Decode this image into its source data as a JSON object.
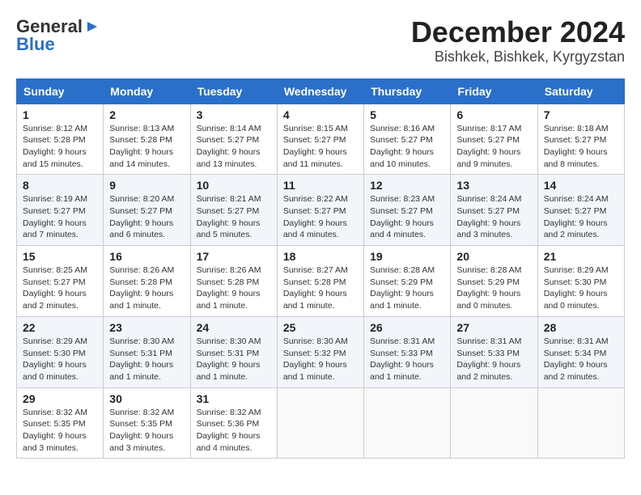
{
  "header": {
    "logo_general": "General",
    "logo_blue": "Blue",
    "month": "December 2024",
    "location": "Bishkek, Bishkek, Kyrgyzstan"
  },
  "weekdays": [
    "Sunday",
    "Monday",
    "Tuesday",
    "Wednesday",
    "Thursday",
    "Friday",
    "Saturday"
  ],
  "weeks": [
    [
      {
        "day": "1",
        "sunrise": "Sunrise: 8:12 AM",
        "sunset": "Sunset: 5:28 PM",
        "daylight": "Daylight: 9 hours and 15 minutes."
      },
      {
        "day": "2",
        "sunrise": "Sunrise: 8:13 AM",
        "sunset": "Sunset: 5:28 PM",
        "daylight": "Daylight: 9 hours and 14 minutes."
      },
      {
        "day": "3",
        "sunrise": "Sunrise: 8:14 AM",
        "sunset": "Sunset: 5:27 PM",
        "daylight": "Daylight: 9 hours and 13 minutes."
      },
      {
        "day": "4",
        "sunrise": "Sunrise: 8:15 AM",
        "sunset": "Sunset: 5:27 PM",
        "daylight": "Daylight: 9 hours and 11 minutes."
      },
      {
        "day": "5",
        "sunrise": "Sunrise: 8:16 AM",
        "sunset": "Sunset: 5:27 PM",
        "daylight": "Daylight: 9 hours and 10 minutes."
      },
      {
        "day": "6",
        "sunrise": "Sunrise: 8:17 AM",
        "sunset": "Sunset: 5:27 PM",
        "daylight": "Daylight: 9 hours and 9 minutes."
      },
      {
        "day": "7",
        "sunrise": "Sunrise: 8:18 AM",
        "sunset": "Sunset: 5:27 PM",
        "daylight": "Daylight: 9 hours and 8 minutes."
      }
    ],
    [
      {
        "day": "8",
        "sunrise": "Sunrise: 8:19 AM",
        "sunset": "Sunset: 5:27 PM",
        "daylight": "Daylight: 9 hours and 7 minutes."
      },
      {
        "day": "9",
        "sunrise": "Sunrise: 8:20 AM",
        "sunset": "Sunset: 5:27 PM",
        "daylight": "Daylight: 9 hours and 6 minutes."
      },
      {
        "day": "10",
        "sunrise": "Sunrise: 8:21 AM",
        "sunset": "Sunset: 5:27 PM",
        "daylight": "Daylight: 9 hours and 5 minutes."
      },
      {
        "day": "11",
        "sunrise": "Sunrise: 8:22 AM",
        "sunset": "Sunset: 5:27 PM",
        "daylight": "Daylight: 9 hours and 4 minutes."
      },
      {
        "day": "12",
        "sunrise": "Sunrise: 8:23 AM",
        "sunset": "Sunset: 5:27 PM",
        "daylight": "Daylight: 9 hours and 4 minutes."
      },
      {
        "day": "13",
        "sunrise": "Sunrise: 8:24 AM",
        "sunset": "Sunset: 5:27 PM",
        "daylight": "Daylight: 9 hours and 3 minutes."
      },
      {
        "day": "14",
        "sunrise": "Sunrise: 8:24 AM",
        "sunset": "Sunset: 5:27 PM",
        "daylight": "Daylight: 9 hours and 2 minutes."
      }
    ],
    [
      {
        "day": "15",
        "sunrise": "Sunrise: 8:25 AM",
        "sunset": "Sunset: 5:27 PM",
        "daylight": "Daylight: 9 hours and 2 minutes."
      },
      {
        "day": "16",
        "sunrise": "Sunrise: 8:26 AM",
        "sunset": "Sunset: 5:28 PM",
        "daylight": "Daylight: 9 hours and 1 minute."
      },
      {
        "day": "17",
        "sunrise": "Sunrise: 8:26 AM",
        "sunset": "Sunset: 5:28 PM",
        "daylight": "Daylight: 9 hours and 1 minute."
      },
      {
        "day": "18",
        "sunrise": "Sunrise: 8:27 AM",
        "sunset": "Sunset: 5:28 PM",
        "daylight": "Daylight: 9 hours and 1 minute."
      },
      {
        "day": "19",
        "sunrise": "Sunrise: 8:28 AM",
        "sunset": "Sunset: 5:29 PM",
        "daylight": "Daylight: 9 hours and 1 minute."
      },
      {
        "day": "20",
        "sunrise": "Sunrise: 8:28 AM",
        "sunset": "Sunset: 5:29 PM",
        "daylight": "Daylight: 9 hours and 0 minutes."
      },
      {
        "day": "21",
        "sunrise": "Sunrise: 8:29 AM",
        "sunset": "Sunset: 5:30 PM",
        "daylight": "Daylight: 9 hours and 0 minutes."
      }
    ],
    [
      {
        "day": "22",
        "sunrise": "Sunrise: 8:29 AM",
        "sunset": "Sunset: 5:30 PM",
        "daylight": "Daylight: 9 hours and 0 minutes."
      },
      {
        "day": "23",
        "sunrise": "Sunrise: 8:30 AM",
        "sunset": "Sunset: 5:31 PM",
        "daylight": "Daylight: 9 hours and 1 minute."
      },
      {
        "day": "24",
        "sunrise": "Sunrise: 8:30 AM",
        "sunset": "Sunset: 5:31 PM",
        "daylight": "Daylight: 9 hours and 1 minute."
      },
      {
        "day": "25",
        "sunrise": "Sunrise: 8:30 AM",
        "sunset": "Sunset: 5:32 PM",
        "daylight": "Daylight: 9 hours and 1 minute."
      },
      {
        "day": "26",
        "sunrise": "Sunrise: 8:31 AM",
        "sunset": "Sunset: 5:33 PM",
        "daylight": "Daylight: 9 hours and 1 minute."
      },
      {
        "day": "27",
        "sunrise": "Sunrise: 8:31 AM",
        "sunset": "Sunset: 5:33 PM",
        "daylight": "Daylight: 9 hours and 2 minutes."
      },
      {
        "day": "28",
        "sunrise": "Sunrise: 8:31 AM",
        "sunset": "Sunset: 5:34 PM",
        "daylight": "Daylight: 9 hours and 2 minutes."
      }
    ],
    [
      {
        "day": "29",
        "sunrise": "Sunrise: 8:32 AM",
        "sunset": "Sunset: 5:35 PM",
        "daylight": "Daylight: 9 hours and 3 minutes."
      },
      {
        "day": "30",
        "sunrise": "Sunrise: 8:32 AM",
        "sunset": "Sunset: 5:35 PM",
        "daylight": "Daylight: 9 hours and 3 minutes."
      },
      {
        "day": "31",
        "sunrise": "Sunrise: 8:32 AM",
        "sunset": "Sunset: 5:36 PM",
        "daylight": "Daylight: 9 hours and 4 minutes."
      },
      null,
      null,
      null,
      null
    ]
  ]
}
